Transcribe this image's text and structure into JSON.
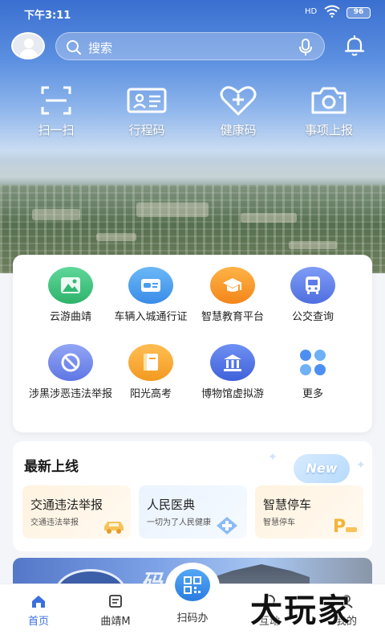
{
  "status_bar": {
    "time": "下午3:11",
    "signal": "HD",
    "battery": "96"
  },
  "header": {
    "search_placeholder": "搜索"
  },
  "quick_actions": [
    {
      "label": "扫一扫",
      "icon": "scan-icon"
    },
    {
      "label": "行程码",
      "icon": "id-card-icon"
    },
    {
      "label": "健康码",
      "icon": "heart-plus-icon"
    },
    {
      "label": "事项上报",
      "icon": "camera-icon"
    }
  ],
  "services": [
    {
      "label": "云游曲靖",
      "icon": "mountain-icon",
      "color": "#3ec07c"
    },
    {
      "label": "车辆入城通行证",
      "icon": "vehicle-card-icon",
      "color": "#4a9ef0"
    },
    {
      "label": "智慧教育平台",
      "icon": "graduation-cap-icon",
      "color": "#f39a2a"
    },
    {
      "label": "公交查询",
      "icon": "bus-icon",
      "color": "#5b7ce8"
    },
    {
      "label": "涉黑涉恶违法举报",
      "icon": "prohibit-icon",
      "color": "#6f86ea"
    },
    {
      "label": "阳光高考",
      "icon": "book-icon",
      "color": "#f2a532"
    },
    {
      "label": "博物馆虚拟游",
      "icon": "museum-icon",
      "color": "#4f72e0"
    },
    {
      "label": "更多",
      "icon": "grid-more-icon",
      "color": "#4c8ff0"
    }
  ],
  "latest": {
    "title": "最新上线",
    "badge": "New",
    "items": [
      {
        "title": "交通违法举报",
        "subtitle": "交通违法举报",
        "icon": "car-icon",
        "bg": "#fff6ea"
      },
      {
        "title": "人民医典",
        "subtitle": "一切为了人民健康",
        "icon": "medical-plus-icon",
        "bg": "#eef5ff"
      },
      {
        "title": "智慧停车",
        "subtitle": "智慧停车",
        "icon": "parking-icon",
        "bg": "#fff6ea"
      }
    ]
  },
  "nav": [
    {
      "label": "首页",
      "icon": "home-icon",
      "active": true
    },
    {
      "label": "曲靖M",
      "icon": "news-icon",
      "active": false
    },
    {
      "label": "扫码办",
      "icon": "qr-code-icon",
      "active": false
    },
    {
      "label": "互动",
      "icon": "interact-icon",
      "active": false
    },
    {
      "label": "我的",
      "icon": "profile-icon",
      "active": false
    }
  ],
  "watermark": "大玩家",
  "accent_color": "#3b6fe0"
}
